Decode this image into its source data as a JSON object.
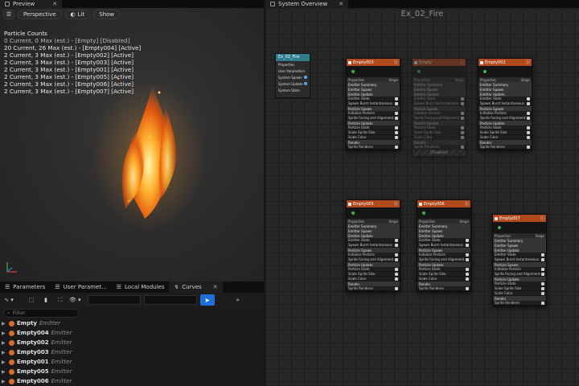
{
  "preview_tab": {
    "label": "Preview"
  },
  "system_tab": {
    "label": "System Overview"
  },
  "toolbar": {
    "perspective": "Perspective",
    "lit": "Lit",
    "show": "Show"
  },
  "counts": {
    "title": "Particle Counts",
    "lines": [
      "0 Current, 0 Max (est.) - [Empty] [Disabled]",
      "20 Current, 26 Max (est.) - [Empty004] [Active]",
      "2 Current, 3 Max (est.) - [Empty002] [Active]",
      "2 Current, 3 Max (est.) - [Empty003] [Active]",
      "2 Current, 3 Max (est.) - [Empty001] [Active]",
      "2 Current, 3 Max (est.) - [Empty005] [Active]",
      "2 Current, 3 Max (est.) - [Empty006] [Active]",
      "2 Current, 3 Max (est.) - [Empty007] [Active]"
    ]
  },
  "bottom_tabs": [
    "Parameters",
    "User Paramet...",
    "Local Modules",
    "Curves"
  ],
  "filter": {
    "placeholder": "Filter"
  },
  "emitters": [
    {
      "name": "Empty",
      "type": "Emitter"
    },
    {
      "name": "Empty004",
      "type": "Emitter"
    },
    {
      "name": "Empty002",
      "type": "Emitter"
    },
    {
      "name": "Empty003",
      "type": "Emitter"
    },
    {
      "name": "Empty001",
      "type": "Emitter"
    },
    {
      "name": "Empty005",
      "type": "Emitter"
    },
    {
      "name": "Empty006",
      "type": "Emitter"
    }
  ],
  "graph": {
    "title": "Ex_02_Fire",
    "system_node": {
      "name": "Ex_02_Fire",
      "rows": [
        "Properties",
        "User Parameters",
        "System Spawn",
        "System Update",
        "System State"
      ]
    },
    "emitter_nodes": [
      {
        "name": "Empty003",
        "disabled": false
      },
      {
        "name": "Empty",
        "disabled": true
      },
      {
        "name": "Empty002",
        "disabled": false
      },
      {
        "name": "Empty005",
        "disabled": false
      },
      {
        "name": "Empty006",
        "disabled": false
      },
      {
        "name": "Empty007",
        "disabled": false
      }
    ],
    "node_rows": {
      "properties": "Properties",
      "stage": "Stage",
      "emitter_summary": "Emitter Summary",
      "emitter_spawn": "Emitter Spawn",
      "emitter_update": "Emitter Update",
      "emitter_state": "Emitter State",
      "spawn_burst": "Spawn Burst Instantaneous",
      "particle_spawn": "Particle Spawn",
      "initialize_particle": "Initialize Particle",
      "sprite_facing": "Sprite Facing and Alignment",
      "particle_update": "Particle Update",
      "particle_state": "Particle State",
      "scale_sprite_size": "Scale Sprite Size",
      "scale_color": "Scale Color",
      "render": "Render",
      "sprite_renderer": "Sprite Renderer",
      "disabled": "Disabled"
    }
  }
}
